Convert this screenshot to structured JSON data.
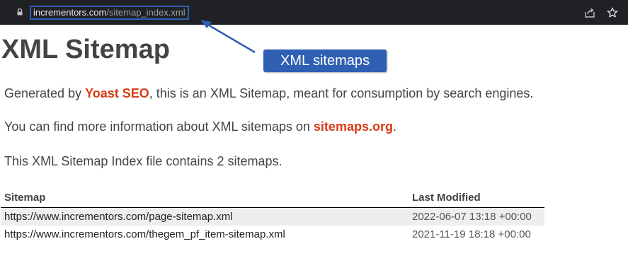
{
  "browser": {
    "url_host": "incrementors.com",
    "url_path": "/sitemap_index.xml",
    "icons": [
      "lock-icon",
      "share-icon",
      "star-icon"
    ]
  },
  "annotation": {
    "callout_text": "XML sitemaps",
    "color": "#2f5fb3"
  },
  "page": {
    "title": "XML Sitemap",
    "p1_before": "Generated by ",
    "p1_link": "Yoast SEO",
    "p1_after": ", this is an XML Sitemap, meant for consumption by search engines.",
    "p2_before": "You can find more information about XML sitemaps on ",
    "p2_link": "sitemaps.org",
    "p2_after": ".",
    "p3": "This XML Sitemap Index file contains 2 sitemaps.",
    "link_color": "#d83b16"
  },
  "table": {
    "headers": [
      "Sitemap",
      "Last Modified"
    ],
    "rows": [
      {
        "sitemap": "https://www.incrementors.com/page-sitemap.xml",
        "modified": "2022-06-07 13:18 +00:00"
      },
      {
        "sitemap": "https://www.incrementors.com/thegem_pf_item-sitemap.xml",
        "modified": "2021-11-19 18:18 +00:00"
      }
    ]
  }
}
